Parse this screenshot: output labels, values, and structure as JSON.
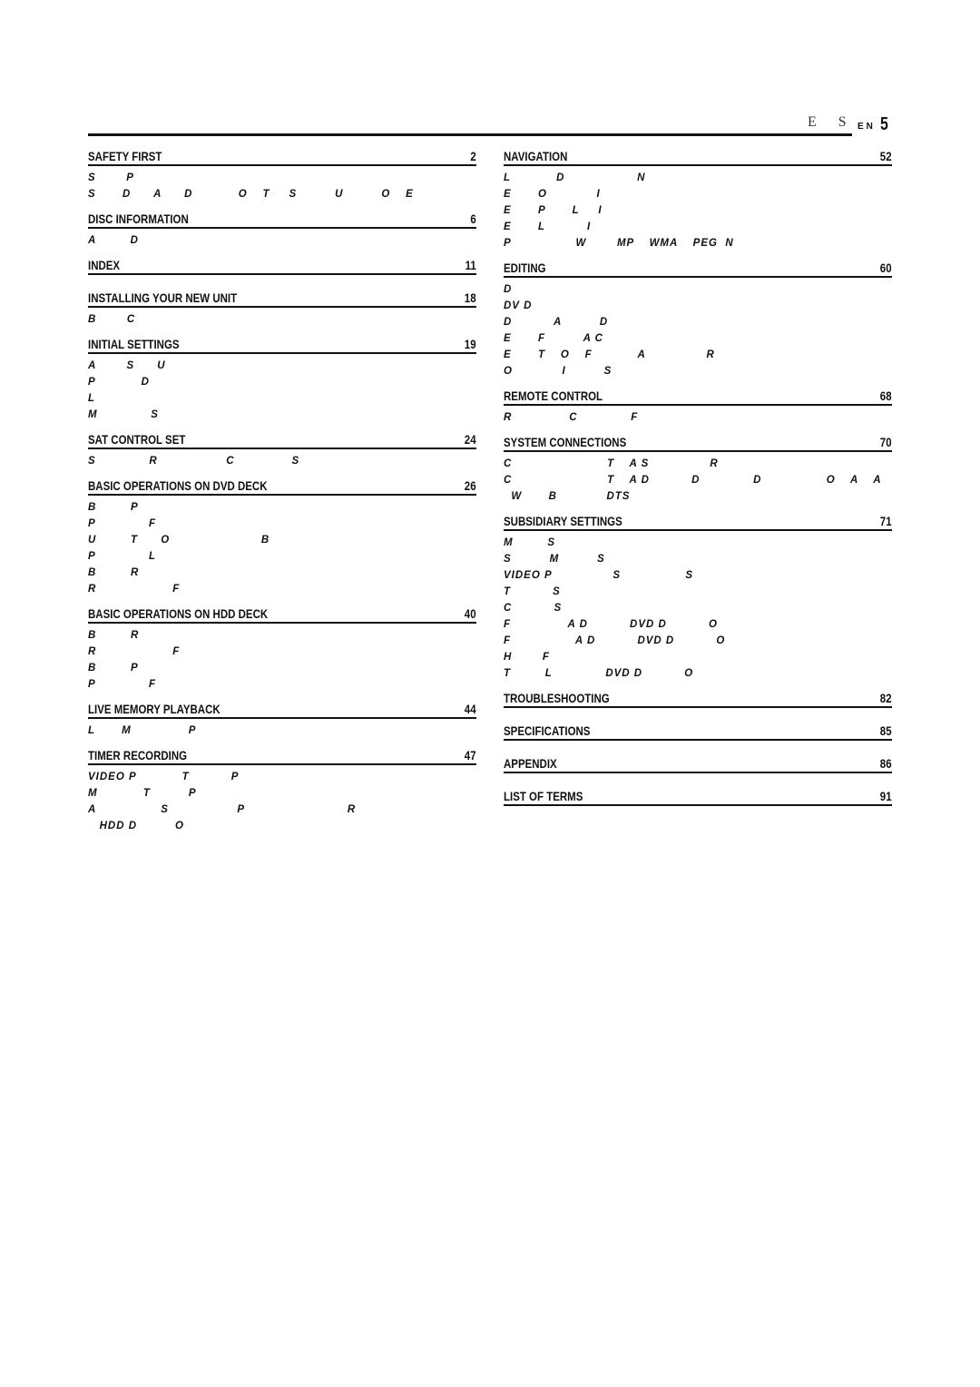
{
  "header": {
    "title": "E S",
    "lang": "EN",
    "page": "5"
  },
  "left": [
    {
      "title": "SAFETY FIRST",
      "page": "2",
      "items": [
        "S        P",
        "S       D      A      D            O    T     S          U          O    E"
      ]
    },
    {
      "title": "DISC INFORMATION",
      "page": "6",
      "items": [
        "A         D"
      ]
    },
    {
      "title": "INDEX",
      "page": "11",
      "items": []
    },
    {
      "title": "INSTALLING YOUR NEW UNIT",
      "page": "18",
      "items": [
        "B        C"
      ]
    },
    {
      "title": "INITIAL SETTINGS",
      "page": "19",
      "items": [
        "A        S      U",
        "P            D",
        "L",
        "M              S"
      ]
    },
    {
      "title": "SAT CONTROL SET",
      "page": "24",
      "items": [
        "S              R                  C               S"
      ]
    },
    {
      "title": "BASIC OPERATIONS ON DVD DECK",
      "page": "26",
      "items": [
        "B         P",
        "P              F",
        "U         T      O                        B",
        "P              L",
        "B         R",
        "R                    F"
      ]
    },
    {
      "title": "BASIC OPERATIONS ON HDD DECK",
      "page": "40",
      "items": [
        "B         R",
        "R                    F",
        "B         P",
        "P              F"
      ]
    },
    {
      "title": "LIVE MEMORY PLAYBACK",
      "page": "44",
      "items": [
        "L       M               P"
      ]
    },
    {
      "title": "TIMER RECORDING",
      "page": "47",
      "items": [
        "VIDEO P            T           P",
        "M            T          P",
        "A                 S                  P                           R",
        "   HDD D          O"
      ]
    }
  ],
  "right": [
    {
      "title": "NAVIGATION",
      "page": "52",
      "items": [
        "L            D                   N",
        "E       O             I",
        "E       P       L     I",
        "E       L           I",
        "P                 W        MP    WMA    PEG  N"
      ]
    },
    {
      "title": "EDITING",
      "page": "60",
      "items": [
        "D",
        "DV D",
        "D           A          D",
        "E       F          A C",
        "E       T    O    F            A                R",
        "O             I          S"
      ]
    },
    {
      "title": "REMOTE CONTROL",
      "page": "68",
      "items": [
        "R               C              F"
      ]
    },
    {
      "title": "SYSTEM CONNECTIONS",
      "page": "70",
      "items": [
        "C                         T    A S                R",
        "C                         T    A D           D              D                 O    A    A",
        "  W       B             DTS"
      ]
    },
    {
      "title": "SUBSIDIARY SETTINGS",
      "page": "71",
      "items": [
        "M         S",
        "S          M          S",
        "VIDEO P                S                 S",
        "T           S",
        "C           S",
        "F               A D           DVD D           O",
        "F                 A D           DVD D           O",
        "H        F",
        "T         L              DVD D           O"
      ]
    },
    {
      "title": "TROUBLESHOOTING",
      "page": "82",
      "items": []
    },
    {
      "title": "SPECIFICATIONS",
      "page": "85",
      "items": []
    },
    {
      "title": "APPENDIX",
      "page": "86",
      "items": []
    },
    {
      "title": "LIST OF TERMS",
      "page": "91",
      "items": []
    }
  ]
}
